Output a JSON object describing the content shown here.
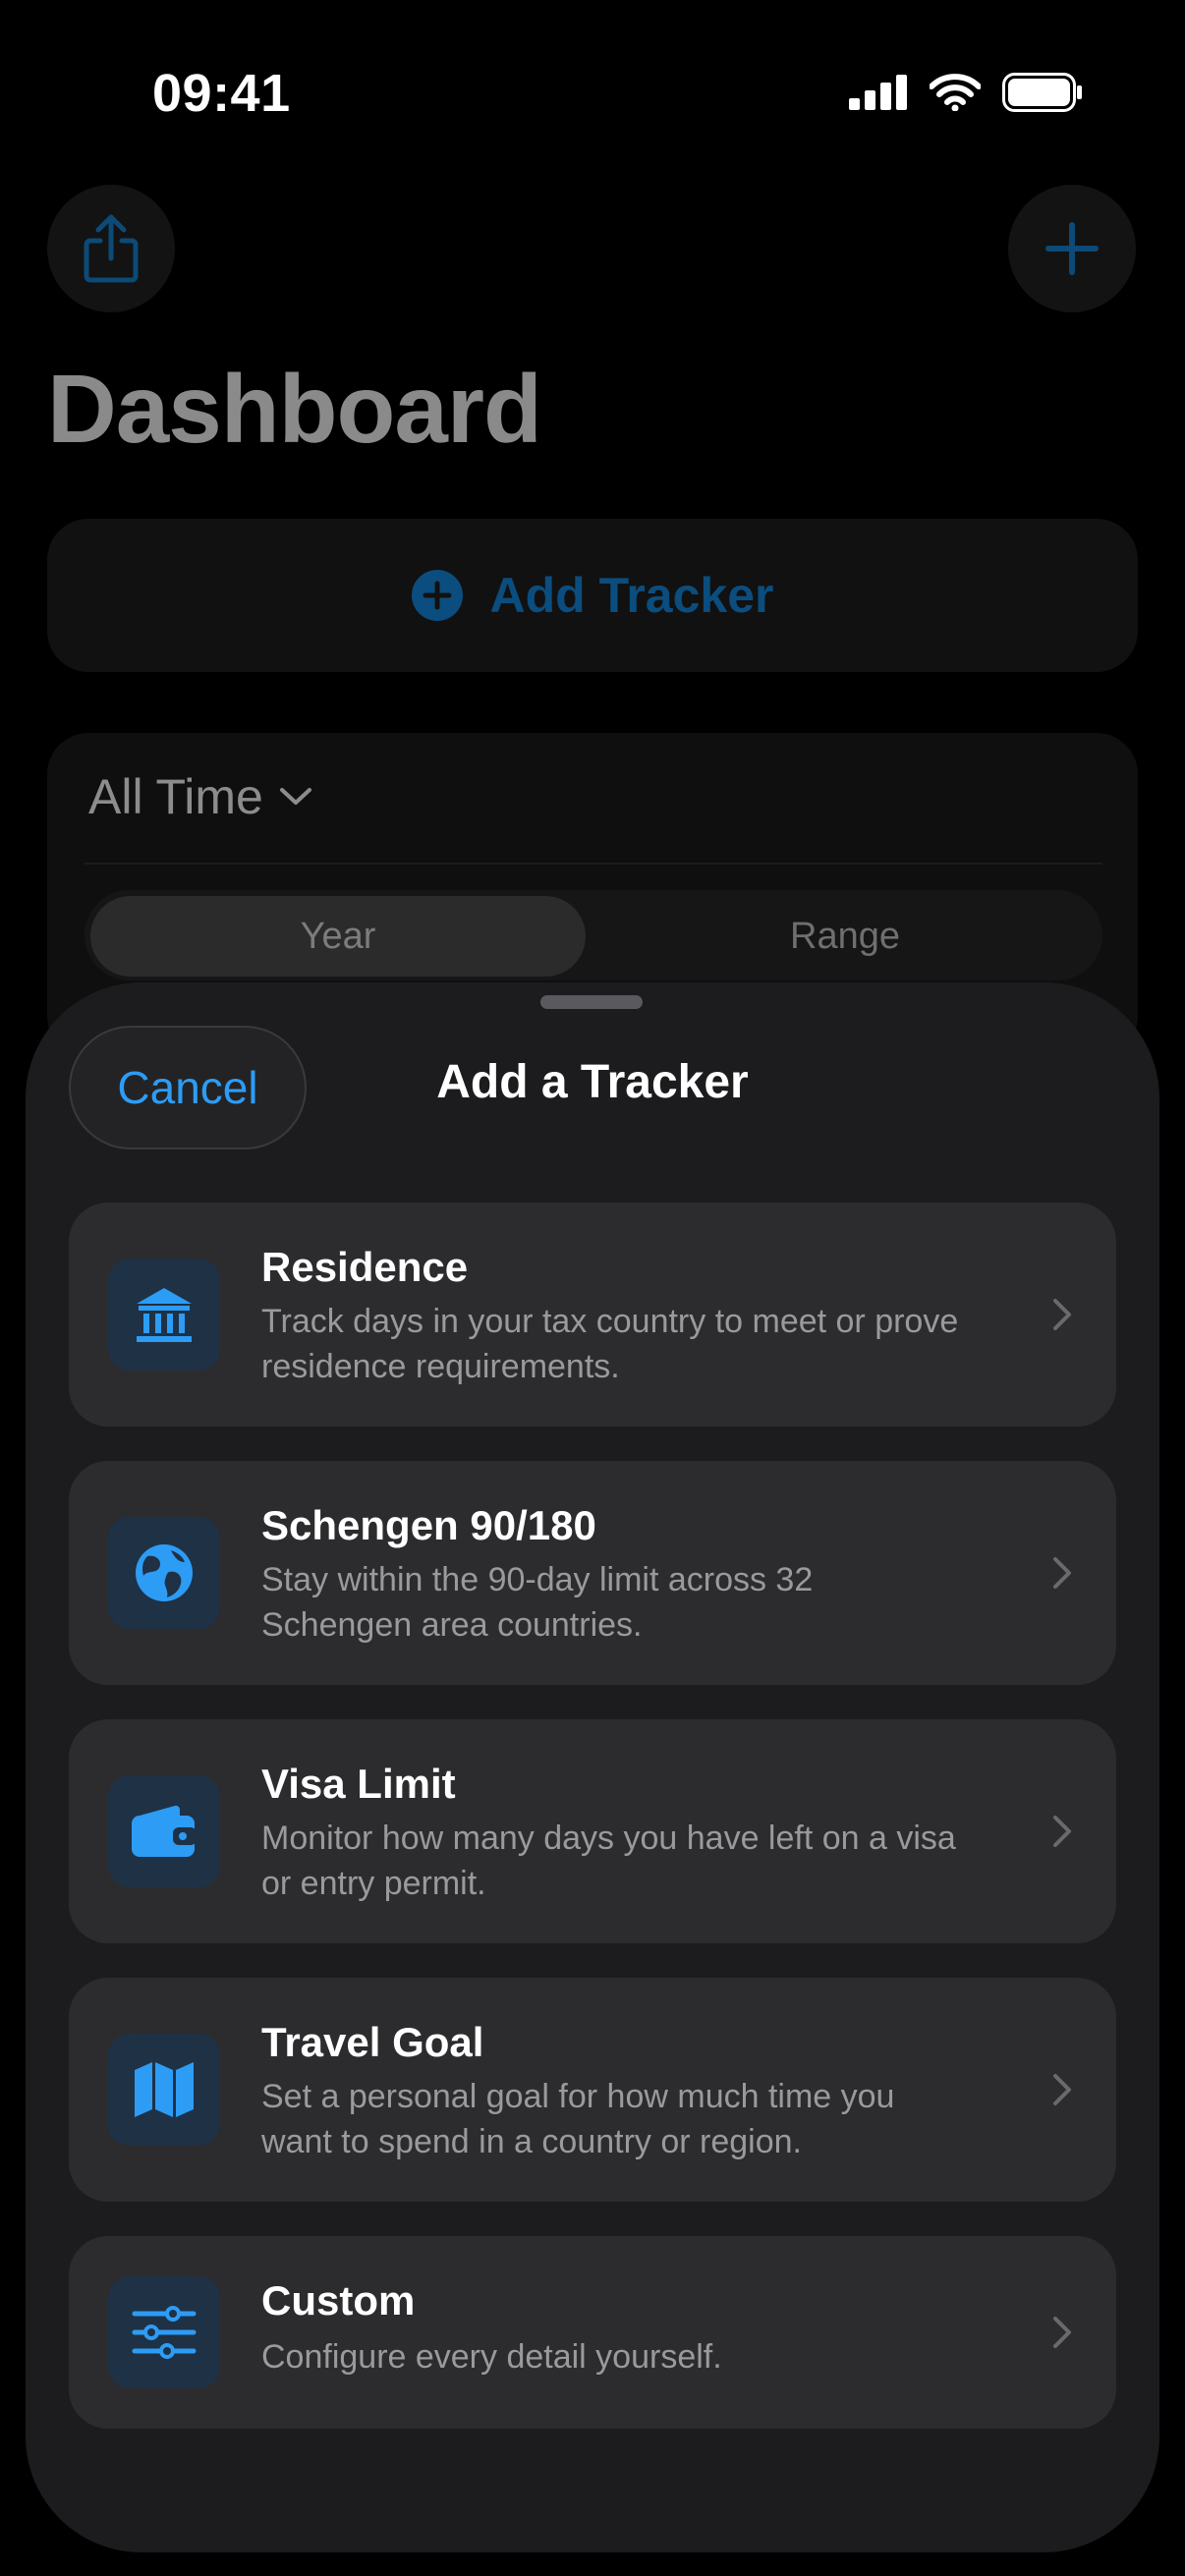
{
  "status_bar": {
    "time": "09:41"
  },
  "dashboard": {
    "title": "Dashboard",
    "add_tracker_label": "Add Tracker",
    "period_label": "All Time",
    "segments": [
      "Year",
      "Range"
    ]
  },
  "sheet": {
    "cancel_label": "Cancel",
    "title": "Add a Tracker",
    "options": [
      {
        "title": "Residence",
        "description": "Track days in your tax country to meet or prove residence requirements.",
        "icon": "bank-icon"
      },
      {
        "title": "Schengen 90/180",
        "description": "Stay within the 90-day limit across 32 Schengen area countries.",
        "icon": "globe-icon"
      },
      {
        "title": "Visa Limit",
        "description": "Monitor how many days you have left on a visa or entry permit.",
        "icon": "wallet-icon"
      },
      {
        "title": "Travel Goal",
        "description": "Set a personal goal for how much time you want to spend in a country or region.",
        "icon": "map-icon"
      },
      {
        "title": "Custom",
        "description": "Configure every detail yourself.",
        "icon": "sliders-icon"
      }
    ]
  },
  "colors": {
    "accent": "#2d9cf5",
    "sheet_bg": "#1c1c1e",
    "row_bg": "#2c2c2e"
  }
}
